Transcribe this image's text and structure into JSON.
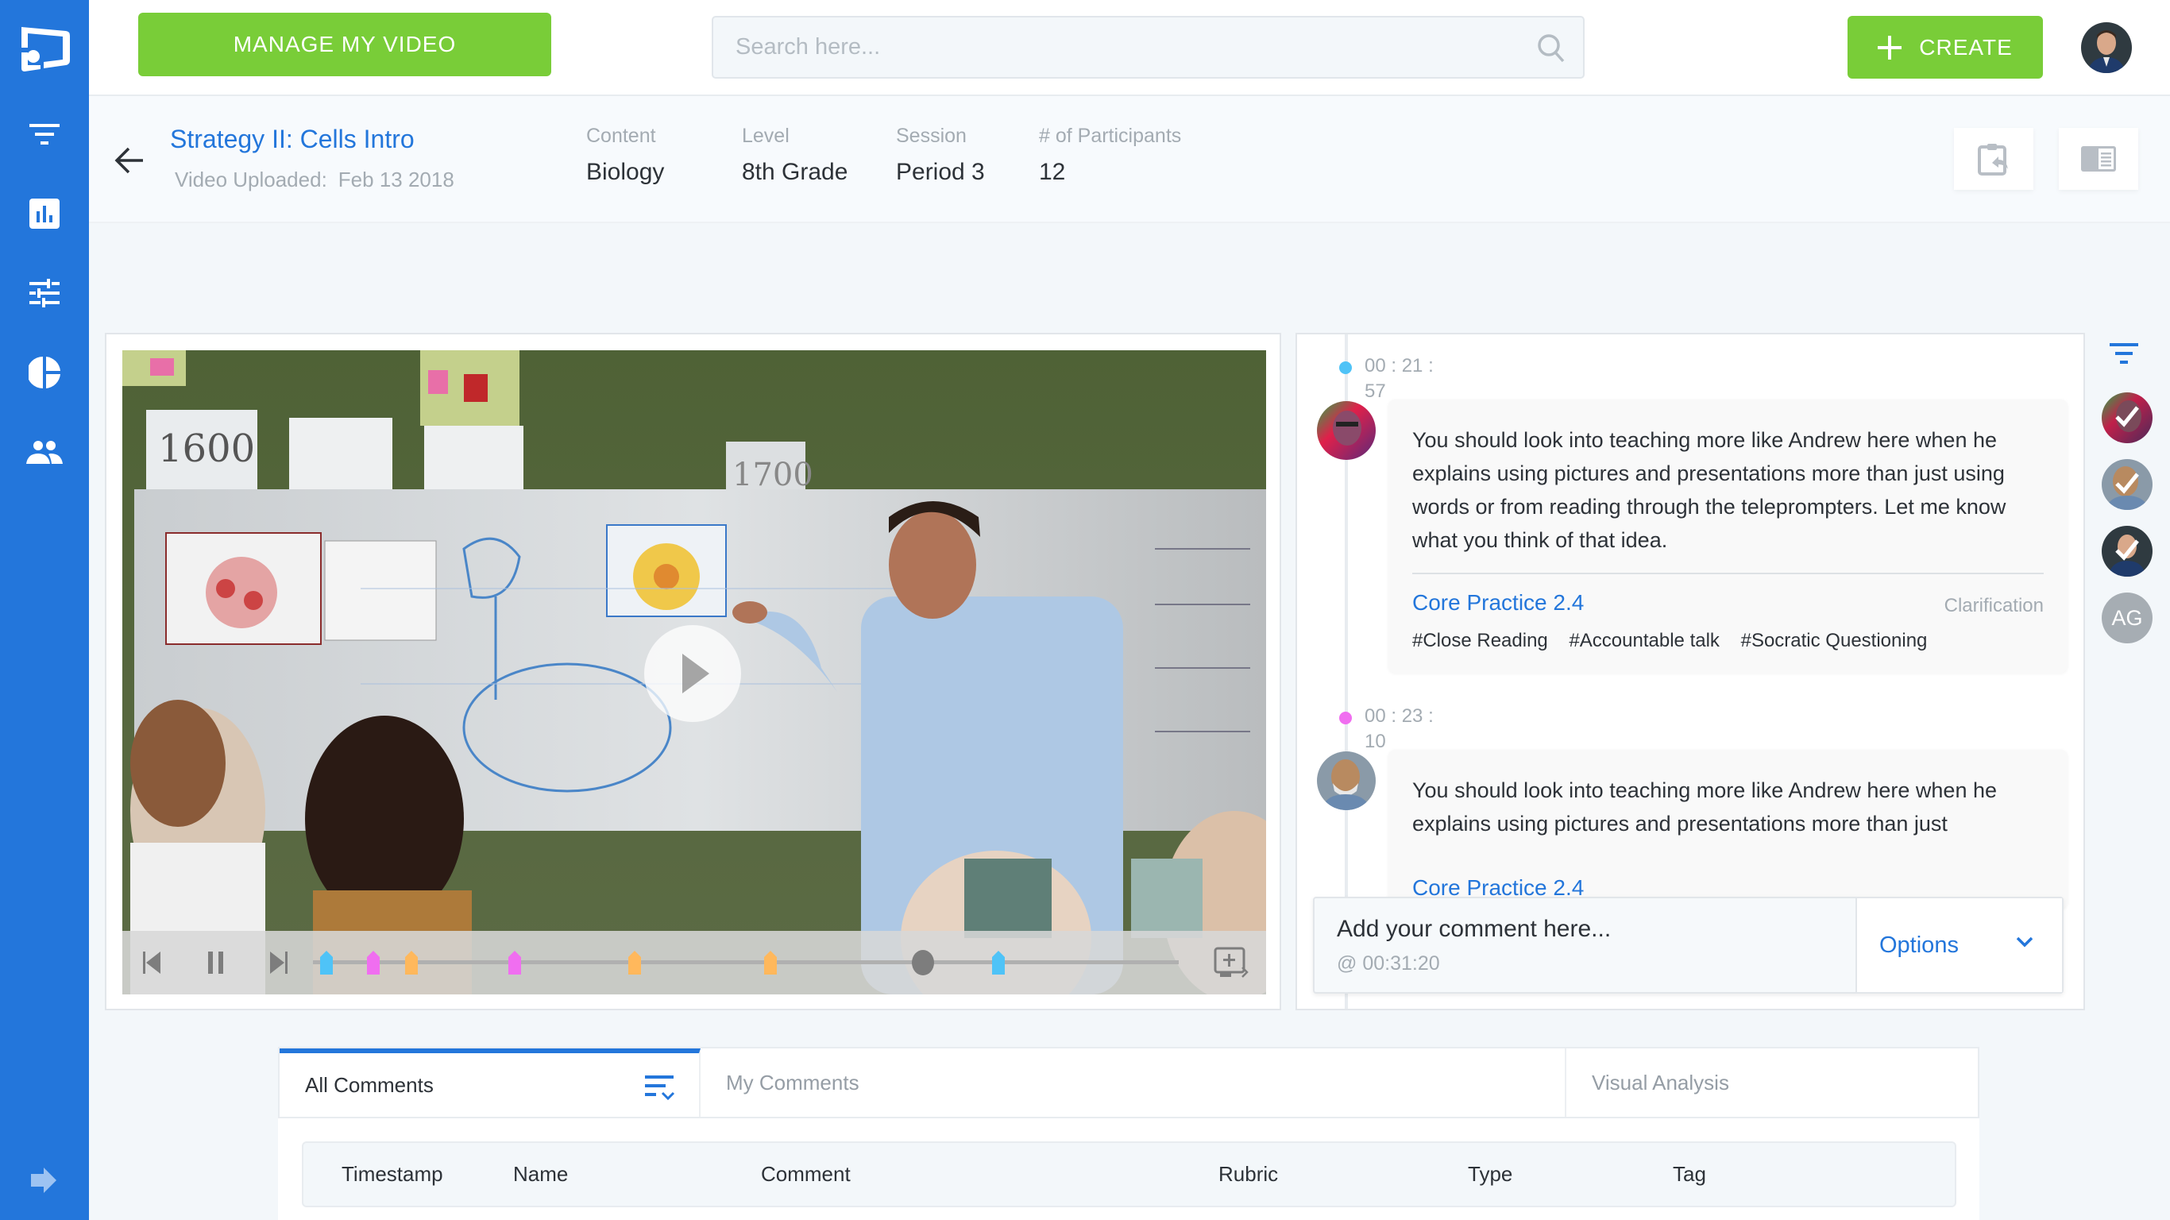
{
  "sidebar": {
    "items": [
      {
        "icon": "logo-icon"
      },
      {
        "icon": "filter-icon"
      },
      {
        "icon": "bar-chart-icon"
      },
      {
        "icon": "tune-icon"
      },
      {
        "icon": "pie-chart-icon"
      },
      {
        "icon": "people-icon"
      },
      {
        "icon": "arrow-right-icon"
      }
    ],
    "accent": "#2376DB"
  },
  "topbar": {
    "manage_label": "MANAGE MY VIDEO",
    "search_placeholder": "Search here...",
    "search_value": "",
    "create_label": "CREATE",
    "button_color": "#79CD38"
  },
  "video_info": {
    "title": "Strategy II: Cells Intro",
    "uploaded_label": "Video Uploaded:",
    "uploaded_date": "Feb 13 2018",
    "meta": [
      {
        "label": "Content",
        "value": "Biology"
      },
      {
        "label": "Level",
        "value": "8th Grade"
      },
      {
        "label": "Session",
        "value": "Period 3"
      },
      {
        "label": "# of Participants",
        "value": "12"
      }
    ]
  },
  "player": {
    "progress": 0.705,
    "markers": [
      {
        "pos": 0.016,
        "color": "#4FC3F7"
      },
      {
        "pos": 0.07,
        "color": "#F06EF0"
      },
      {
        "pos": 0.114,
        "color": "#FFB85C"
      },
      {
        "pos": 0.233,
        "color": "#F06EF0"
      },
      {
        "pos": 0.372,
        "color": "#FFB85C"
      },
      {
        "pos": 0.528,
        "color": "#FFB85C"
      },
      {
        "pos": 0.792,
        "color": "#4FC3F7"
      }
    ]
  },
  "comments": [
    {
      "time_line1": "00 : 21 :",
      "time_line2": "57",
      "dot_color": "#4FC3F7",
      "text": "You should look into teaching more like Andrew here when he explains using pictures and presentations more than just using words or from reading through the teleprompters. Let me know what you think of that idea.",
      "rubric": "Core Practice 2.4",
      "type": "Clarification",
      "tags": [
        "#Close Reading",
        "#Accountable talk",
        "#Socratic Questioning"
      ]
    },
    {
      "time_line1": "00 : 23 :",
      "time_line2": "10",
      "dot_color": "#F06EF0",
      "text": "You should look into teaching more like Andrew here when he explains using pictures and presentations more than just",
      "rubric": "Core Practice 2.4"
    }
  ],
  "comment_input": {
    "placeholder": "Add your comment here...",
    "timestamp": "@ 00:31:20",
    "options_label": "Options"
  },
  "participants_rail": {
    "initials": "AG"
  },
  "tabs": [
    {
      "label": "All Comments",
      "active": true
    },
    {
      "label": "My Comments",
      "active": false
    },
    {
      "label": "Visual Analysis",
      "active": false
    }
  ],
  "table": {
    "columns": [
      "Timestamp",
      "Name",
      "Comment",
      "Rubric",
      "Type",
      "Tag"
    ]
  }
}
